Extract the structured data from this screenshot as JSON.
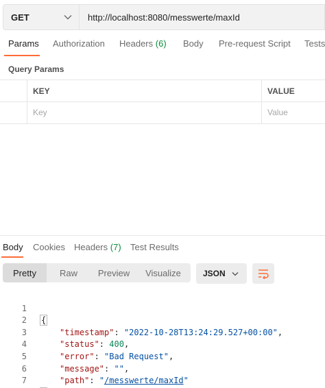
{
  "request": {
    "method": "GET",
    "url": "http://localhost:8080/messwerte/maxId"
  },
  "request_tabs": {
    "params": "Params",
    "authorization": "Authorization",
    "headers": "Headers",
    "headers_count": "(6)",
    "body": "Body",
    "pre_request_script": "Pre-request Script",
    "tests": "Tests"
  },
  "query_params": {
    "title": "Query Params",
    "key_header": "KEY",
    "value_header": "VALUE",
    "key_placeholder": "Key",
    "value_placeholder": "Value"
  },
  "response_tabs": {
    "body": "Body",
    "cookies": "Cookies",
    "headers": "Headers",
    "headers_count": "(7)",
    "test_results": "Test Results"
  },
  "view_modes": {
    "pretty": "Pretty",
    "raw": "Raw",
    "preview": "Preview",
    "visualize": "Visualize"
  },
  "format": "JSON",
  "response_json": {
    "line_numbers": [
      "1",
      "2",
      "3",
      "4",
      "5",
      "6",
      "7"
    ],
    "open_brace": "{",
    "close_brace": "}",
    "timestamp_key": "\"timestamp\"",
    "timestamp_value": "\"2022-10-28T13:24:29.527+00:00\"",
    "status_key": "\"status\"",
    "status_value": "400",
    "error_key": "\"error\"",
    "error_value": "\"Bad Request\"",
    "message_key": "\"message\"",
    "message_value": "\"\"",
    "path_key": "\"path\"",
    "path_value": "/messwerte/maxId"
  },
  "colors": {
    "accent": "#ff6c37",
    "count_green": "#0a8a3c",
    "json_key": "#a31515",
    "json_string": "#0451a5",
    "json_number": "#098658"
  }
}
